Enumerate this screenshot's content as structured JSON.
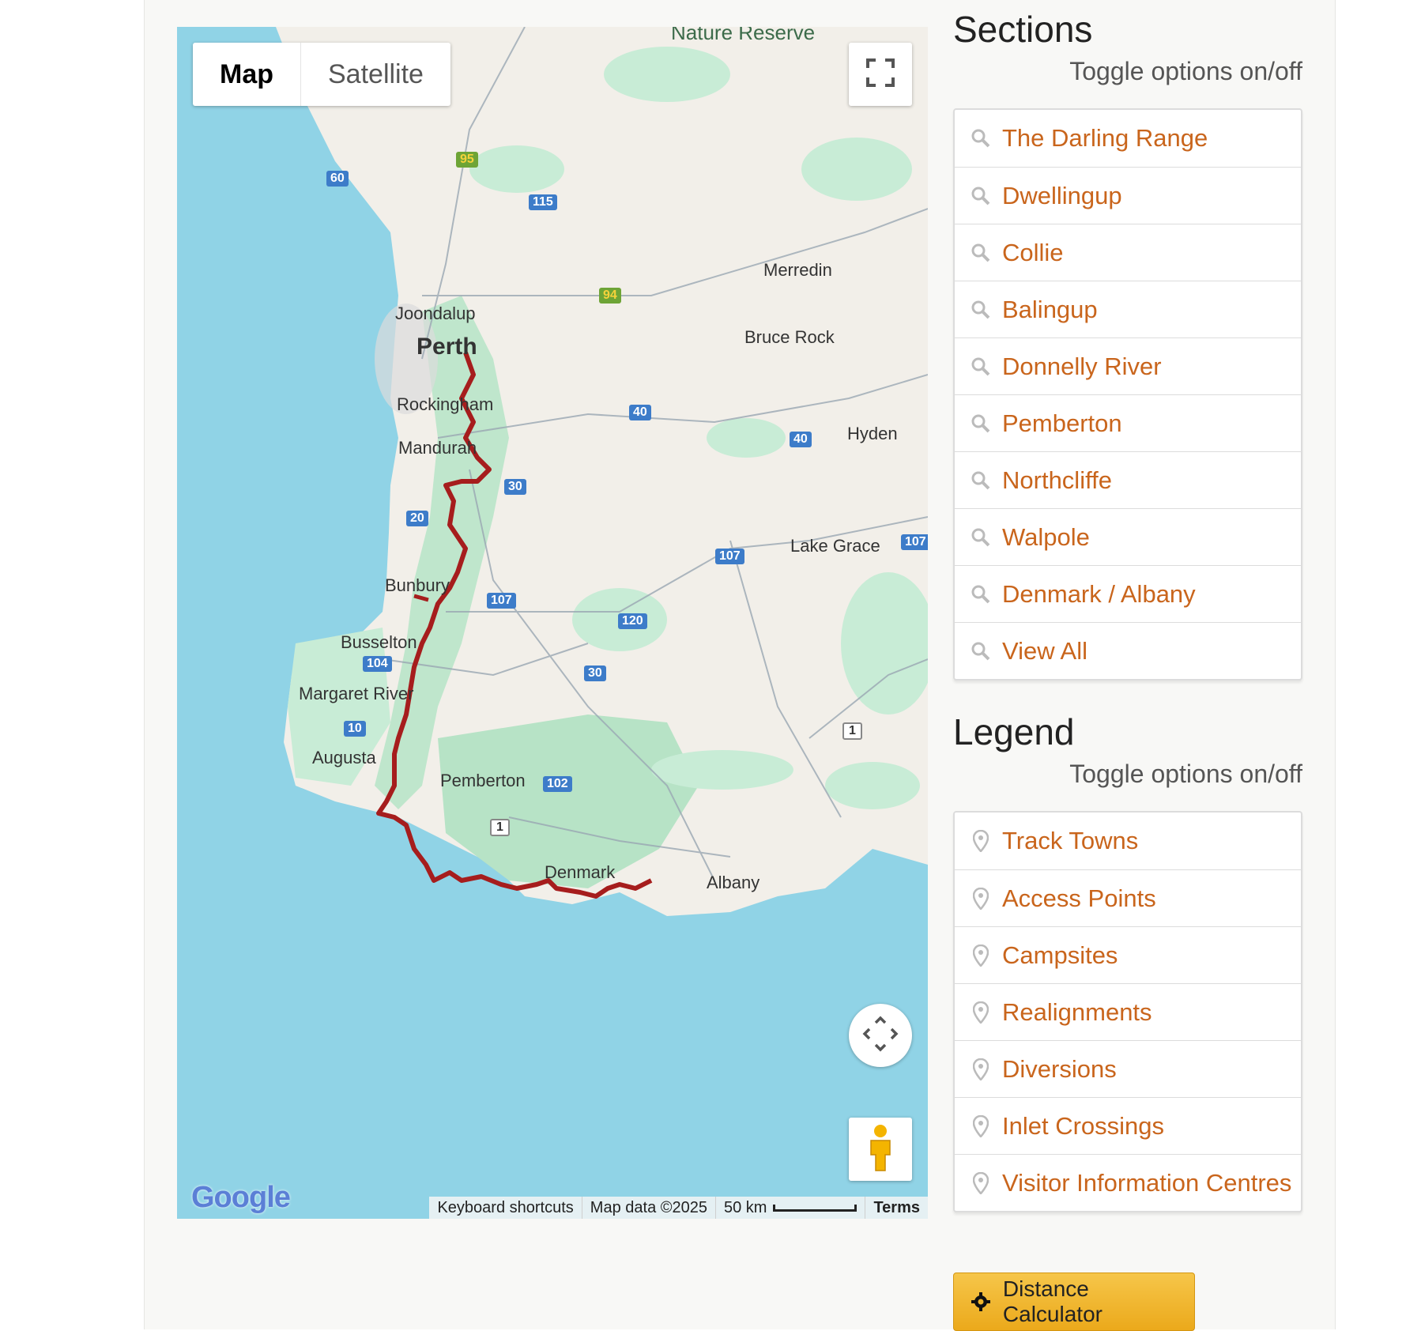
{
  "map": {
    "type_buttons": [
      "Map",
      "Satellite"
    ],
    "logo": "Google",
    "attribution": {
      "shortcuts": "Keyboard shortcuts",
      "data": "Map data ©2025",
      "scale": "50 km",
      "terms": "Terms"
    },
    "top_label": "Nature Reserve",
    "places": [
      "Joondalup",
      "Perth",
      "Rockingham",
      "Mandurah",
      "Bunbury",
      "Busselton",
      "Margaret River",
      "Augusta",
      "Pemberton",
      "Denmark",
      "Albany",
      "Merredin",
      "Bruce Rock",
      "Hyden",
      "Lake Grace"
    ],
    "road_shields": [
      "60",
      "95",
      "115",
      "94",
      "40",
      "40",
      "30",
      "20",
      "107",
      "107",
      "107",
      "120",
      "104",
      "30",
      "10",
      "102",
      "1",
      "1"
    ],
    "colors": {
      "water": "#90d3e6",
      "land": "#f2efe9",
      "park": "#c8ecd6",
      "forest": "#a9dcbb",
      "trail": "#a61d1d"
    }
  },
  "sidebar": {
    "sections_title": "Sections",
    "sections_sub": "Toggle options on/off",
    "sections": [
      "The Darling Range",
      "Dwellingup",
      "Collie",
      "Balingup",
      "Donnelly River",
      "Pemberton",
      "Northcliffe",
      "Walpole",
      "Denmark / Albany",
      "View All"
    ],
    "legend_title": "Legend",
    "legend_sub": "Toggle options on/off",
    "legend": [
      "Track Towns",
      "Access Points",
      "Campsites",
      "Realignments",
      "Diversions",
      "Inlet Crossings",
      "Visitor Information Centres"
    ],
    "calculator": "Distance Calculator",
    "accent_color": "#c9651c"
  }
}
